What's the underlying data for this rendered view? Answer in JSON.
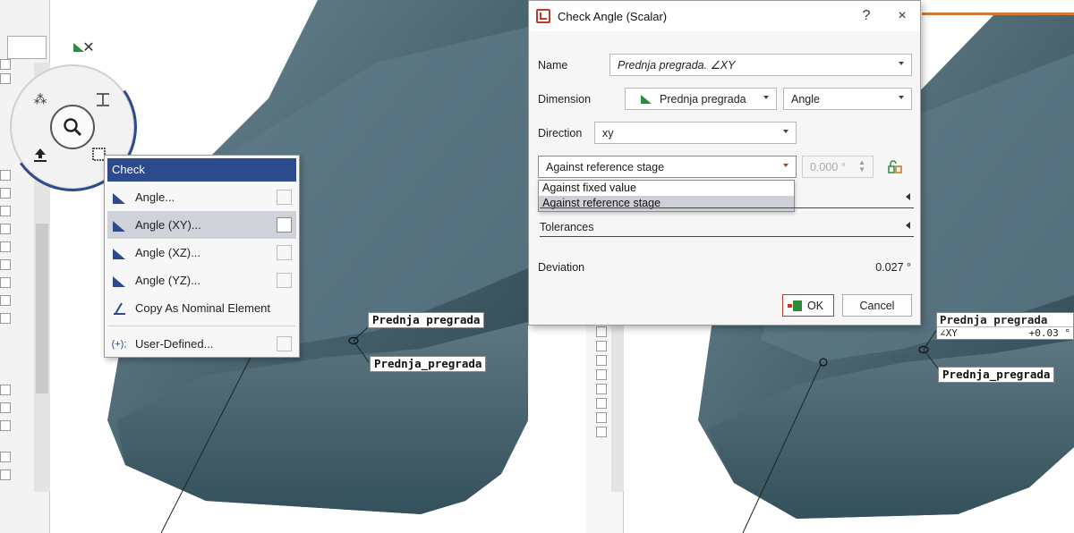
{
  "left": {
    "context_menu": {
      "header": "Check",
      "items": [
        {
          "icon": "angle-icon",
          "glyph": "xy z",
          "label": "Angle..."
        },
        {
          "icon": "angle-xy-icon",
          "glyph": "x y",
          "label": "Angle (XY)..."
        },
        {
          "icon": "angle-xz-icon",
          "glyph": "x z",
          "label": "Angle (XZ)..."
        },
        {
          "icon": "angle-yz-icon",
          "glyph": "y z",
          "label": "Angle (YZ)..."
        },
        {
          "icon": "copy-nominal-icon",
          "glyph": "⊿",
          "label": "Copy As Nominal Element"
        },
        {
          "icon": "user-defined-icon",
          "glyph": "(+);",
          "label": "User-Defined..."
        }
      ]
    },
    "labels": {
      "upper": "Prednja pregrada",
      "lower": "Prednja_pregrada"
    }
  },
  "dialog": {
    "title": "Check Angle (Scalar)",
    "help": "?",
    "close": "×",
    "name_label": "Name",
    "name_value": "Prednja pregrada. ∠XY",
    "dimension_label": "Dimension",
    "dimension_element": "Prednja pregrada",
    "dimension_type": "Angle",
    "direction_label": "Direction",
    "direction_value": "xy",
    "reference_mode": "Against reference stage",
    "reference_value": "0.000 °",
    "dropdown_options": [
      "Against fixed value",
      "Against reference stage"
    ],
    "tolerances_label": "Tolerances",
    "deviation_label": "Deviation",
    "deviation_value": "0.027 °",
    "ok_label": "OK",
    "cancel_label": "Cancel"
  },
  "right": {
    "labels": {
      "upper_name": "Prednja pregrada",
      "upper_measure": "∠XY",
      "upper_value": "+0.03 °",
      "lower": "Prednja_pregrada"
    }
  },
  "colors": {
    "accent": "#2d4a8c",
    "model_dark": "#2f4a56",
    "model_mid": "#46626d",
    "model_light": "#6d8792",
    "highlight": "#cdd0d6",
    "ok_red": "#c0392b"
  }
}
